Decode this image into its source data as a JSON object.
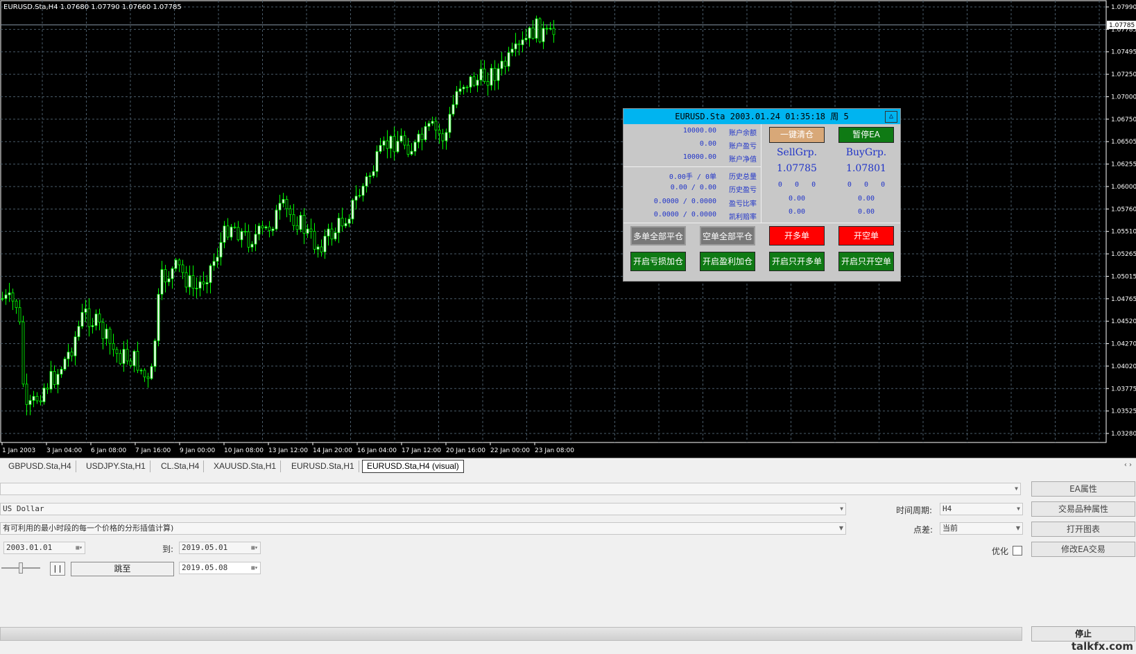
{
  "chart": {
    "symbol_info": "EURUSD.Sta,H4  1.07680 1.07790 1.07660 1.07785",
    "price_labels": [
      "1.07990",
      "1.07785",
      "1.07495",
      "1.07250",
      "1.07000",
      "1.06750",
      "1.06505",
      "1.06255",
      "1.06000",
      "1.05760",
      "1.05510",
      "1.05265",
      "1.05015",
      "1.04765",
      "1.04520",
      "1.04270",
      "1.04020",
      "1.03775",
      "1.03525",
      "1.03280"
    ],
    "current_price": "1.07785",
    "time_labels": [
      "1 Jan 2003",
      "3 Jan 04:00",
      "6 Jan 08:00",
      "7 Jan 16:00",
      "9 Jan 00:00",
      "10 Jan 08:00",
      "13 Jan 12:00",
      "14 Jan 20:00",
      "16 Jan 04:00",
      "17 Jan 12:00",
      "20 Jan 16:00",
      "22 Jan 00:00",
      "23 Jan 08:00"
    ],
    "colors": {
      "background": "#000000",
      "bull": "#ffffff",
      "bear": "#000000",
      "wick": "#00ff00",
      "grid": "#4a5c6a"
    }
  },
  "ea_panel": {
    "title": "EURUSD.Sta   2003.01.24 01:35:18   周 5",
    "collapse_glyph": "△",
    "account": [
      {
        "value": "10000.00",
        "label": "账户余额"
      },
      {
        "value": "0.00",
        "label": "账户盈亏"
      },
      {
        "value": "10000.00",
        "label": "账户净值"
      }
    ],
    "history": [
      {
        "value": "0.00手 / 0单",
        "label": "历史总量"
      },
      {
        "value": "0.00 / 0.00",
        "label": "历史盈亏"
      },
      {
        "value": "0.0000 / 0.0000",
        "label": "盈亏比率"
      },
      {
        "value": "0.0000 / 0.0000",
        "label": "凯利赔率"
      }
    ],
    "close_all_button": "一键清仓",
    "pause_ea_button": "暂停EA",
    "sell_group": {
      "name": "SellGrp.",
      "price": "1.07785",
      "counts": "0   0   0",
      "value1": "0.00",
      "value2": "0.00"
    },
    "buy_group": {
      "name": "BuyGrp.",
      "price": "1.07801",
      "counts": "0   0   0",
      "value1": "0.00",
      "value2": "0.00"
    },
    "buttons": {
      "close_all_long": "多单全部平仓",
      "close_all_short": "空单全部平仓",
      "open_long": "开多单",
      "open_short": "开空单",
      "enable_loss_add": "开启亏损加仓",
      "enable_profit_add": "开启盈利加仓",
      "only_long": "开启只开多单",
      "only_short": "开启只开空单"
    },
    "colors": {
      "title_bar": "#00b4f0",
      "panel_bg": "#c8c8c8",
      "text": "#2034c8",
      "green_button": "#0f7a14",
      "red_button": "#ff0000",
      "tan_button": "#d8a878"
    }
  },
  "tabs": [
    "GBPUSD.Sta,H4",
    "USDJPY.Sta,H1",
    "CL.Sta,H4",
    "XAUUSD.Sta,H1",
    "EURUSD.Sta,H1",
    "EURUSD.Sta,H4 (visual)"
  ],
  "tester": {
    "symbol_value": "US Dollar",
    "model_value": "有可利用的最小时段的每一个价格的分形插值计算)",
    "period_label": "时间周期:",
    "period_value": "H4",
    "spread_label": "点差:",
    "spread_value": "当前",
    "optimize_label": "优化",
    "from_date": "2003.01.01",
    "to_label": "到:",
    "to_date": "2019.05.01",
    "pause_glyph": "| |",
    "jump_button": "跳至",
    "jump_date": "2019.05.08",
    "ea_props_button": "EA属性",
    "symbol_props_button": "交易品种属性",
    "open_chart_button": "打开图表",
    "modify_ea_button": "修改EA交易",
    "stop_button": "停止",
    "slider_level": 0.5
  },
  "watermark": "talkfx.com"
}
